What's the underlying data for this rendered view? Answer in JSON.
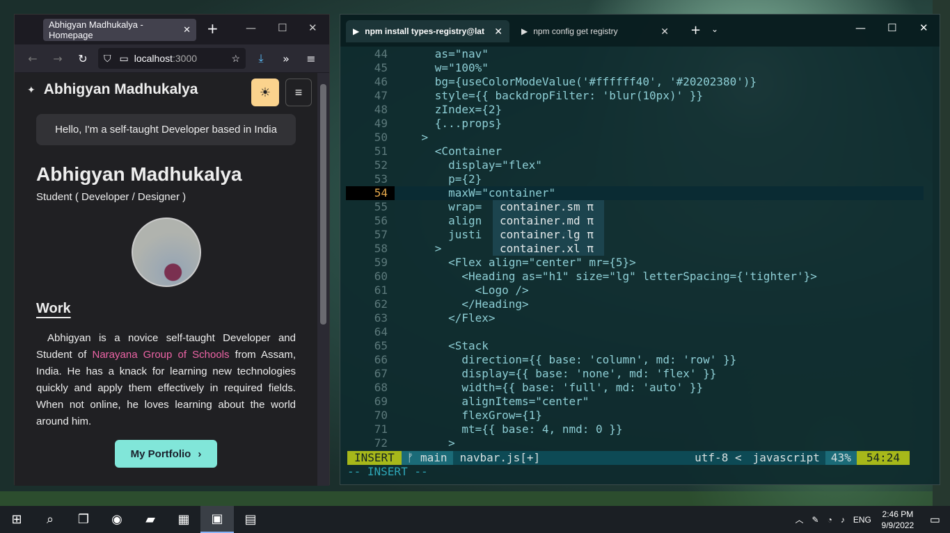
{
  "taskbar": {
    "items": [
      {
        "name": "start",
        "glyph": "⊞"
      },
      {
        "name": "search",
        "glyph": "⌕"
      },
      {
        "name": "task-view",
        "glyph": "❐"
      },
      {
        "name": "firefox",
        "glyph": "◉"
      },
      {
        "name": "file-explorer",
        "glyph": "▰"
      },
      {
        "name": "store",
        "glyph": "▦"
      },
      {
        "name": "terminal",
        "glyph": "▣"
      },
      {
        "name": "app",
        "glyph": "▤"
      }
    ],
    "tray": {
      "language": "ENG",
      "time": "2:46 PM",
      "date": "9/9/2022"
    }
  },
  "firefox": {
    "tab_title": "Abhigyan Madhukalya - Homepage",
    "url_host": "localhost",
    "url_port": ":3000",
    "site": {
      "logo": "Abhigyan Madhukalya",
      "hello": "Hello, I'm a self-taught Developer based in India",
      "name": "Abhigyan Madhukalya",
      "subtitle": "Student ( Developer / Designer )",
      "work_heading": "Work",
      "para_1": "Abhigyan is a novice self-taught Developer and Student of ",
      "para_link": "Narayana Group of Schools",
      "para_2": " from Assam, India. He has a knack for learning new technologies quickly and apply them effectively in required fields. When not online, he loves learning about the world around him.",
      "portfolio_button": "My Portfolio"
    }
  },
  "terminal": {
    "tabs": [
      {
        "title": "npm install types-registry@lat"
      },
      {
        "title": "npm config get registry"
      }
    ],
    "code_lines": [
      {
        "n": "44",
        "t": "      as=\"nav\""
      },
      {
        "n": "45",
        "t": "      w=\"100%\""
      },
      {
        "n": "46",
        "t": "      bg={useColorModeValue('#ffffff40', '#20202380')}"
      },
      {
        "n": "47",
        "t": "      style={{ backdropFilter: 'blur(10px)' }}"
      },
      {
        "n": "48",
        "t": "      zIndex={2}"
      },
      {
        "n": "49",
        "t": "      {...props}"
      },
      {
        "n": "50",
        "t": "    >"
      },
      {
        "n": "51",
        "t": "      <Container"
      },
      {
        "n": "52",
        "t": "        display=\"flex\""
      },
      {
        "n": "53",
        "t": "        p={2}"
      },
      {
        "n": "54",
        "t": "        maxW=\"container\""
      },
      {
        "n": "55",
        "t": "        wrap="
      },
      {
        "n": "56",
        "t": "        align"
      },
      {
        "n": "57",
        "t": "        justi            n\""
      },
      {
        "n": "58",
        "t": "      >"
      },
      {
        "n": "59",
        "t": "        <Flex align=\"center\" mr={5}>"
      },
      {
        "n": "60",
        "t": "          <Heading as=\"h1\" size=\"lg\" letterSpacing={'tighter'}>"
      },
      {
        "n": "61",
        "t": "            <Logo />"
      },
      {
        "n": "62",
        "t": "          </Heading>"
      },
      {
        "n": "63",
        "t": "        </Flex>"
      },
      {
        "n": "64",
        "t": ""
      },
      {
        "n": "65",
        "t": "        <Stack"
      },
      {
        "n": "66",
        "t": "          direction={{ base: 'column', md: 'row' }}"
      },
      {
        "n": "67",
        "t": "          display={{ base: 'none', md: 'flex' }}"
      },
      {
        "n": "68",
        "t": "          width={{ base: 'full', md: 'auto' }}"
      },
      {
        "n": "69",
        "t": "          alignItems=\"center\""
      },
      {
        "n": "70",
        "t": "          flexGrow={1}"
      },
      {
        "n": "71",
        "t": "          mt={{ base: 4, nmd: 0 }}"
      },
      {
        "n": "72",
        "t": "        >"
      }
    ],
    "current_line": "54",
    "suggestions": [
      "container.sm π",
      "container.md π",
      "container.lg π",
      "container.xl π"
    ],
    "status": {
      "mode": "INSERT",
      "branch": "ᚠ main",
      "file": "navbar.js[+]",
      "encoding": "utf-8 <",
      "language": "javascript",
      "percent": "43%",
      "position": "54:24"
    },
    "cmdline": "-- INSERT --"
  }
}
